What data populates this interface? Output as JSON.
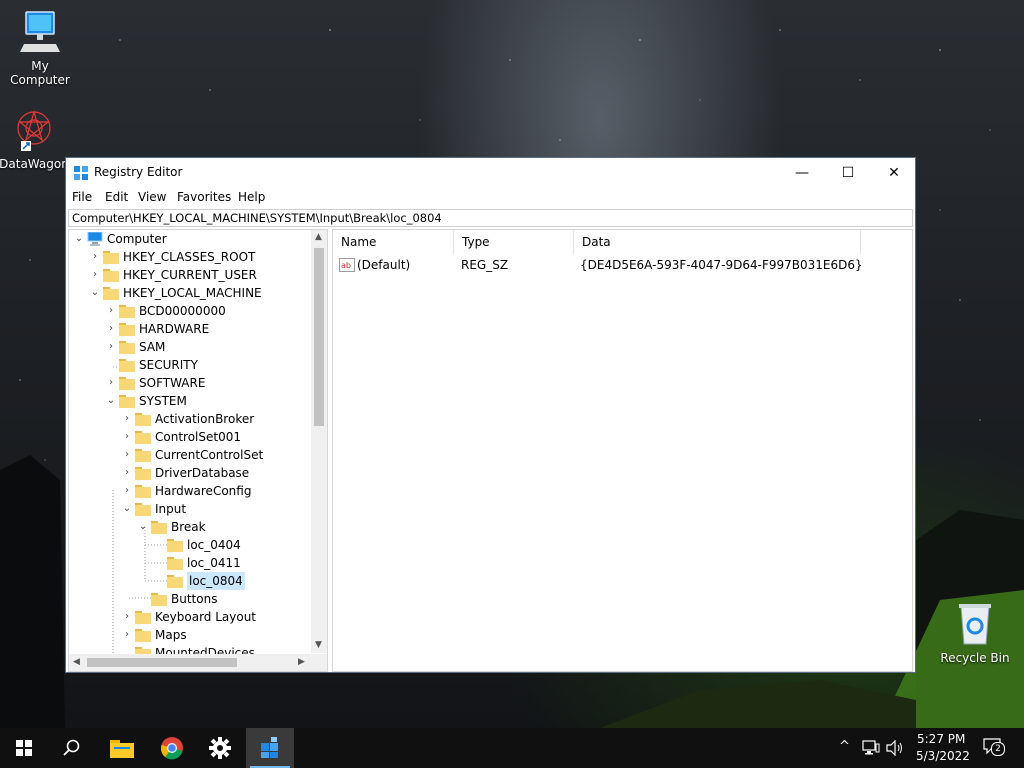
{
  "desktop": {
    "icons": [
      {
        "label": "My Computer"
      },
      {
        "label": "DataWagon"
      },
      {
        "label": "Recycle Bin"
      }
    ]
  },
  "window": {
    "title": "Registry Editor",
    "controls": {
      "minimize": "—",
      "maximize": "☐",
      "close": "✕"
    },
    "menu": [
      "File",
      "Edit",
      "View",
      "Favorites",
      "Help"
    ],
    "address": "Computer\\HKEY_LOCAL_MACHINE\\SYSTEM\\Input\\Break\\loc_0804"
  },
  "tree": {
    "root": "Computer",
    "items": [
      {
        "label": "HKEY_CLASSES_ROOT",
        "expander": "›"
      },
      {
        "label": "HKEY_CURRENT_USER",
        "expander": "›"
      },
      {
        "label": "HKEY_LOCAL_MACHINE",
        "expander": "⌄"
      },
      {
        "label": "BCD00000000",
        "expander": "›"
      },
      {
        "label": "HARDWARE",
        "expander": "›"
      },
      {
        "label": "SAM",
        "expander": "›"
      },
      {
        "label": "SECURITY",
        "expander": ""
      },
      {
        "label": "SOFTWARE",
        "expander": "›"
      },
      {
        "label": "SYSTEM",
        "expander": "⌄"
      },
      {
        "label": "ActivationBroker",
        "expander": "›"
      },
      {
        "label": "ControlSet001",
        "expander": "›"
      },
      {
        "label": "CurrentControlSet",
        "expander": "›"
      },
      {
        "label": "DriverDatabase",
        "expander": "›"
      },
      {
        "label": "HardwareConfig",
        "expander": "›"
      },
      {
        "label": "Input",
        "expander": "⌄"
      },
      {
        "label": "Break",
        "expander": "⌄"
      },
      {
        "label": "loc_0404",
        "expander": ""
      },
      {
        "label": "loc_0411",
        "expander": ""
      },
      {
        "label": "loc_0804",
        "expander": ""
      },
      {
        "label": "Buttons",
        "expander": ""
      },
      {
        "label": "Keyboard Layout",
        "expander": "›"
      },
      {
        "label": "Maps",
        "expander": "›"
      },
      {
        "label": "MountedDevices",
        "expander": ""
      }
    ]
  },
  "list": {
    "columns": [
      "Name",
      "Type",
      "Data"
    ],
    "rows": [
      {
        "name": "(Default)",
        "type": "REG_SZ",
        "data": "{DE4D5E6A-593F-4047-9D64-F997B031E6D6}"
      }
    ]
  },
  "taskbar": {
    "time": "5:27 PM",
    "date": "5/3/2022",
    "notifications": "2"
  },
  "colors": {
    "selection": "#cce8ff",
    "folder": "#f8d775",
    "taskbar": "#101010",
    "accent": "#76b9ed"
  }
}
